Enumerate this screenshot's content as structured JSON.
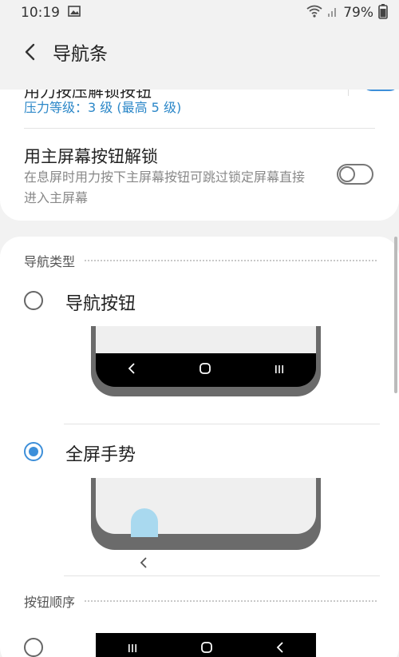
{
  "status_bar": {
    "time": "10:19",
    "battery": "79%"
  },
  "app_bar": {
    "title": "导航条"
  },
  "pressure_row": {
    "title": "用力按压解锁按钮",
    "subtitle": "压力等级：3 级 (最高 5 级)",
    "toggle_on": true
  },
  "home_unlock_row": {
    "title": "用主屏幕按钮解锁",
    "description_line1": "在息屏时用力按下主屏幕按钮可跳过锁定屏幕直接",
    "description_line2": "进入主屏幕",
    "toggle_on": false
  },
  "nav_type_section": {
    "header": "导航类型",
    "options": [
      {
        "label": "导航按钮",
        "selected": false
      },
      {
        "label": "全屏手势",
        "selected": true
      }
    ]
  },
  "button_order_section": {
    "header": "按钮顺序"
  },
  "colors": {
    "accent": "#3d8fd9",
    "subtitle_blue": "#2b87c8",
    "background": "#f2f2f2",
    "card": "#ffffff"
  }
}
